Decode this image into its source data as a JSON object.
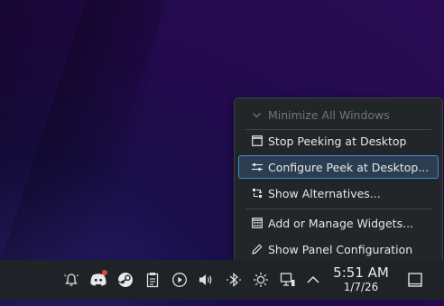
{
  "menu": {
    "items": [
      {
        "label": "Minimize All Windows",
        "icon": "chevron-down-icon",
        "disabled": true
      },
      {
        "label": "Stop Peeking at Desktop",
        "icon": "window-icon"
      },
      {
        "label": "Configure Peek at Desktop...",
        "icon": "sliders-icon",
        "highlighted": true
      },
      {
        "label": "Show Alternatives...",
        "icon": "alternatives-icon"
      },
      {
        "label": "Add or Manage Widgets...",
        "icon": "widgets-icon"
      },
      {
        "label": "Show Panel Configuration",
        "icon": "pencil-icon"
      }
    ]
  },
  "taskbar": {
    "tray_icons": [
      "notifications-icon",
      "discord-icon",
      "steam-icon",
      "clipboard-icon",
      "media-play-icon",
      "volume-icon",
      "bluetooth-icon",
      "brightness-icon",
      "network-icon",
      "expand-tray-icon"
    ],
    "clock": {
      "time": "5:51 AM",
      "date": "1/7/26"
    },
    "show_desktop_icon": "show-desktop-icon"
  },
  "colors": {
    "accent": "#3d8dd0",
    "menu_bg": "#232629",
    "panel_bg": "#1f2226",
    "badge": "#e0453a"
  }
}
